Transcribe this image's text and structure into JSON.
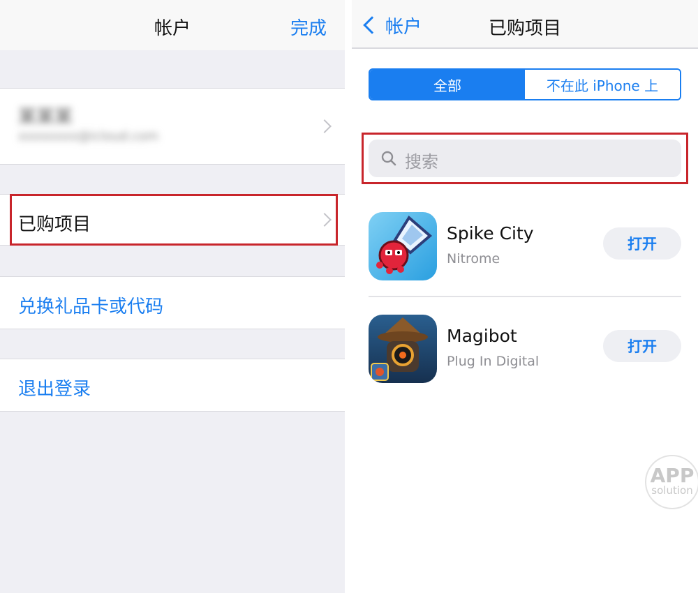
{
  "left": {
    "title": "帐户",
    "done": "完成",
    "account": {
      "name": "某某某",
      "email": "xxxxxxxx@icloud.com"
    },
    "purchased": "已购项目",
    "redeem": "兑换礼品卡或代码",
    "signout": "退出登录"
  },
  "right": {
    "back": "帐户",
    "title": "已购项目",
    "segments": [
      "全部",
      "不在此 iPhone 上"
    ],
    "search_placeholder": "搜索",
    "apps": [
      {
        "name": "Spike City",
        "developer": "Nitrome",
        "action": "打开"
      },
      {
        "name": "Magibot",
        "developer": "Plug In Digital",
        "action": "打开"
      }
    ]
  },
  "watermark": {
    "top": "APP",
    "bottom": "solution"
  },
  "colors": {
    "accent": "#1a7ef0",
    "highlight": "#c8252b",
    "background": "#efeff4"
  }
}
